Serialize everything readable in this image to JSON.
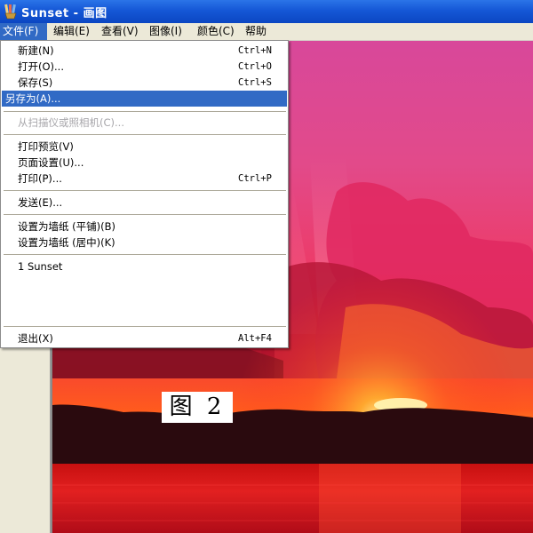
{
  "window": {
    "title": "Sunset - 画图",
    "icon": "paint-brush-icon"
  },
  "menubar": {
    "items": [
      {
        "label": "文件(F)",
        "active": true
      },
      {
        "label": "编辑(E)"
      },
      {
        "label": "查看(V)"
      },
      {
        "label": "图像(I)"
      },
      {
        "label": "颜色(C)"
      },
      {
        "label": "帮助(H)"
      }
    ]
  },
  "file_menu": {
    "new": {
      "label": "新建(N)",
      "shortcut": "Ctrl+N"
    },
    "open": {
      "label": "打开(O)...",
      "shortcut": "Ctrl+O"
    },
    "save": {
      "label": "保存(S)",
      "shortcut": "Ctrl+S"
    },
    "save_as": {
      "label": "另存为(A)..."
    },
    "from_scanner": {
      "label": "从扫描仪或照相机(C)..."
    },
    "print_preview": {
      "label": "打印预览(V)"
    },
    "page_setup": {
      "label": "页面设置(U)..."
    },
    "print": {
      "label": "打印(P)...",
      "shortcut": "Ctrl+P"
    },
    "send": {
      "label": "发送(E)..."
    },
    "wallpaper_tiled": {
      "label": "设置为墙纸 (平铺)(B)"
    },
    "wallpaper_centered": {
      "label": "设置为墙纸 (居中)(K)"
    },
    "recent_file": {
      "label": "1 Sunset"
    },
    "exit": {
      "label": "退出(X)",
      "shortcut": "Alt+F4"
    }
  },
  "caption": {
    "text": "图 2"
  },
  "colors": {
    "titlebar": "#1557d6",
    "menu_highlight": "#316ac5",
    "window_face": "#ece9d8"
  }
}
